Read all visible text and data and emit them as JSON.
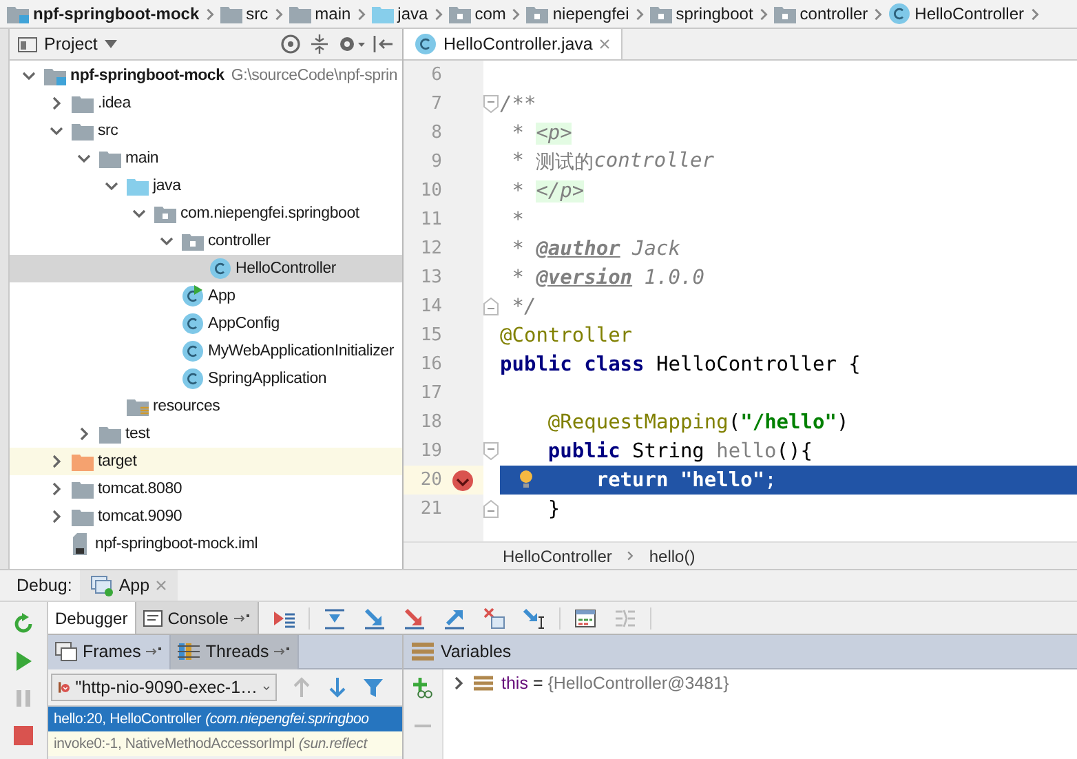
{
  "nav_bar": {
    "items": [
      {
        "label": "npf-springboot-mock",
        "kind": "module"
      },
      {
        "label": "src",
        "kind": "folder"
      },
      {
        "label": "main",
        "kind": "folder"
      },
      {
        "label": "java",
        "kind": "source"
      },
      {
        "label": "com",
        "kind": "package"
      },
      {
        "label": "niepengfei",
        "kind": "package"
      },
      {
        "label": "springboot",
        "kind": "package"
      },
      {
        "label": "controller",
        "kind": "package"
      },
      {
        "label": "HelloController",
        "kind": "class"
      }
    ]
  },
  "project_panel": {
    "title": "Project",
    "tree": [
      {
        "label": "npf-springboot-mock",
        "hint": "G:\\sourceCode\\npf-sprin",
        "kind": "module",
        "expanded": true,
        "selected": false,
        "children": [
          {
            "label": ".idea",
            "kind": "folder",
            "expanded": false,
            "selected": false
          },
          {
            "label": "src",
            "kind": "folder",
            "expanded": true,
            "selected": false,
            "children": [
              {
                "label": "main",
                "kind": "folder",
                "expanded": true,
                "selected": false,
                "children": [
                  {
                    "label": "java",
                    "kind": "source",
                    "expanded": true,
                    "selected": false,
                    "children": [
                      {
                        "label": "com.niepengfei.springboot",
                        "kind": "package",
                        "expanded": true,
                        "selected": false,
                        "children": [
                          {
                            "label": "controller",
                            "kind": "package",
                            "expanded": true,
                            "selected": false,
                            "children": [
                              {
                                "label": "HelloController",
                                "kind": "class",
                                "selected": true
                              }
                            ]
                          },
                          {
                            "label": "App",
                            "kind": "run_class",
                            "selected": false
                          },
                          {
                            "label": "AppConfig",
                            "kind": "class",
                            "selected": false
                          },
                          {
                            "label": "MyWebApplicationInitializer",
                            "kind": "class",
                            "selected": false
                          },
                          {
                            "label": "SpringApplication",
                            "kind": "class",
                            "selected": false
                          }
                        ]
                      }
                    ]
                  },
                  {
                    "label": "resources",
                    "kind": "resources",
                    "selected": false
                  }
                ]
              },
              {
                "label": "test",
                "kind": "folder",
                "expanded": false,
                "selected": false
              }
            ]
          },
          {
            "label": "target",
            "kind": "excluded",
            "expanded": false,
            "selected": false
          },
          {
            "label": "tomcat.8080",
            "kind": "folder",
            "expanded": false,
            "selected": false
          },
          {
            "label": "tomcat.9090",
            "kind": "folder",
            "expanded": false,
            "selected": false
          },
          {
            "label": "npf-springboot-mock.iml",
            "kind": "file",
            "selected": false
          }
        ]
      }
    ]
  },
  "editor": {
    "tabs": [
      {
        "label": "HelloController.java",
        "selected": true
      }
    ],
    "lines": [
      {
        "number": "6",
        "breakpoint": false,
        "current": false,
        "fold_start": false,
        "fold_end": false
      },
      {
        "number": "7",
        "breakpoint": false,
        "current": false,
        "fold_start": true,
        "fold_end": false,
        "tokens": [
          {
            "text": "/**",
            "kind": "comment"
          }
        ]
      },
      {
        "number": "8",
        "breakpoint": false,
        "current": false,
        "fold_start": false,
        "fold_end": false,
        "tokens": [
          {
            "text": " * ",
            "kind": "comment"
          },
          {
            "text": "<p>",
            "kind": "html"
          }
        ]
      },
      {
        "number": "9",
        "breakpoint": false,
        "current": false,
        "fold_start": false,
        "fold_end": false,
        "tokens": [
          {
            "text": " * ",
            "kind": "comment"
          },
          {
            "text": "测试的",
            "kind": "comment_cjk"
          },
          {
            "text": "controller",
            "kind": "comment"
          }
        ]
      },
      {
        "number": "10",
        "breakpoint": false,
        "current": false,
        "fold_start": false,
        "fold_end": false,
        "tokens": [
          {
            "text": " * ",
            "kind": "comment"
          },
          {
            "text": "</p>",
            "kind": "html"
          }
        ]
      },
      {
        "number": "11",
        "breakpoint": false,
        "current": false,
        "fold_start": false,
        "fold_end": false,
        "tokens": [
          {
            "text": " *",
            "kind": "comment"
          }
        ]
      },
      {
        "number": "12",
        "breakpoint": false,
        "current": false,
        "fold_start": false,
        "fold_end": false,
        "tokens": [
          {
            "text": " * ",
            "kind": "comment"
          },
          {
            "text": "@author",
            "kind": "doctag"
          },
          {
            "text": " Jack",
            "kind": "comment"
          }
        ]
      },
      {
        "number": "13",
        "breakpoint": false,
        "current": false,
        "fold_start": false,
        "fold_end": false,
        "tokens": [
          {
            "text": " * ",
            "kind": "comment"
          },
          {
            "text": "@version",
            "kind": "doctag"
          },
          {
            "text": " 1.0.0",
            "kind": "comment"
          }
        ]
      },
      {
        "number": "14",
        "breakpoint": false,
        "current": false,
        "fold_start": false,
        "fold_end": true,
        "tokens": [
          {
            "text": " */",
            "kind": "comment"
          }
        ]
      },
      {
        "number": "15",
        "breakpoint": false,
        "current": false,
        "fold_start": false,
        "fold_end": false,
        "tokens": [
          {
            "text": "@Controller",
            "kind": "annotation"
          }
        ]
      },
      {
        "number": "16",
        "breakpoint": false,
        "current": false,
        "fold_start": false,
        "fold_end": false,
        "tokens": [
          {
            "text": "public class ",
            "kind": "keyword"
          },
          {
            "text": "HelloController {",
            "kind": "plain"
          }
        ]
      },
      {
        "number": "17",
        "breakpoint": false,
        "current": false,
        "fold_start": false,
        "fold_end": false
      },
      {
        "number": "18",
        "breakpoint": false,
        "current": false,
        "fold_start": false,
        "fold_end": false,
        "tokens": [
          {
            "text": "    @RequestMapping",
            "kind": "annotation"
          },
          {
            "text": "(",
            "kind": "plain"
          },
          {
            "text": "\"/hello\"",
            "kind": "string"
          },
          {
            "text": ")",
            "kind": "plain"
          }
        ]
      },
      {
        "number": "19",
        "breakpoint": false,
        "current": false,
        "fold_start": true,
        "fold_end": false,
        "tokens": [
          {
            "text": "    public ",
            "kind": "keyword"
          },
          {
            "text": "String ",
            "kind": "plain"
          },
          {
            "text": "hello",
            "kind": "unused"
          },
          {
            "text": "(){",
            "kind": "plain"
          }
        ]
      },
      {
        "number": "20",
        "breakpoint": true,
        "current": true,
        "fold_start": false,
        "fold_end": false,
        "tokens": [
          {
            "text": "        return ",
            "kind": "keyword"
          },
          {
            "text": "\"hello\"",
            "kind": "string"
          },
          {
            "text": ";",
            "kind": "plain"
          }
        ]
      },
      {
        "number": "21",
        "breakpoint": false,
        "current": false,
        "fold_start": false,
        "fold_end": true,
        "tokens": [
          {
            "text": "    }",
            "kind": "plain"
          }
        ]
      }
    ],
    "breadcrumb": [
      "HelloController",
      "hello()"
    ]
  },
  "debug": {
    "title": "Debug:",
    "sessions": [
      {
        "label": "App",
        "selected": true
      }
    ],
    "tabs": [
      {
        "label": "Debugger",
        "selected": true,
        "pinnable": false
      },
      {
        "label": "Console",
        "selected": false,
        "pinnable": true
      }
    ],
    "frame_tabs": [
      {
        "label": "Frames",
        "selected": true
      },
      {
        "label": "Threads",
        "selected": false
      }
    ],
    "thread": "\"http-nio-9090-exec-1…",
    "frames": [
      {
        "method": "hello:20, HelloController",
        "location": "(com.niepengfei.springboo",
        "selected": true
      },
      {
        "method": "invoke0:-1, NativeMethodAccessorImpl",
        "location": "(sun.reflect",
        "selected": false
      }
    ],
    "variables_title": "Variables",
    "variables": [
      {
        "name": "this",
        "operator": "=",
        "value": "{HelloController@3481}",
        "expanded": false
      }
    ]
  }
}
